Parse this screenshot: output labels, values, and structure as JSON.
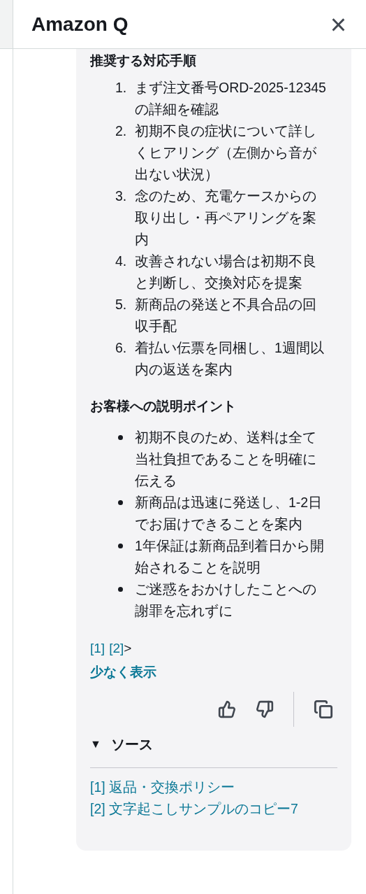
{
  "panel": {
    "title": "Amazon Q",
    "close": "×"
  },
  "message": {
    "steps_heading": "推奨する対応手順",
    "steps": [
      {
        "number": "1.",
        "text": "まず注文番号ORD-2025-12345の詳細を確認"
      },
      {
        "number": "2.",
        "text": "初期不良の症状について詳しくヒアリング（左側から音が出ない状況）"
      },
      {
        "number": "3.",
        "text": "念のため、充電ケースからの取り出し・再ペアリングを案内"
      },
      {
        "number": "4.",
        "text": "改善されない場合は初期不良と判断し、交換対応を提案"
      },
      {
        "number": "5.",
        "text": "新商品の発送と不具合品の回収手配"
      },
      {
        "number": "6.",
        "text": "着払い伝票を同梱し、1週間以内の返送を案内"
      }
    ],
    "points_heading": "お客様への説明ポイント",
    "points": [
      "初期不良のため、送料は全て当社負担であることを明確に伝える",
      "新商品は迅速に発送し、1-2日でお届けできることを案内",
      "1年保証は新商品到着日から開始されることを説明",
      "ご迷惑をおかけしたことへの謝罪を忘れずに"
    ],
    "citations": [
      "[1]",
      "[2]"
    ],
    "citations_more": ">",
    "show_less": "少なく表示",
    "sources": {
      "toggle": "▼",
      "label": "ソース",
      "expanded": true,
      "items": [
        "[1] 返品・交換ポリシー",
        "[2] 文字起こしサンプルのコピー7"
      ]
    }
  }
}
